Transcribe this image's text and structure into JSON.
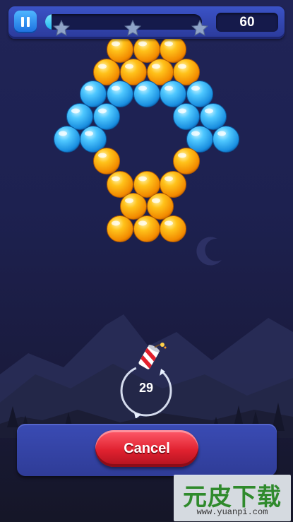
{
  "hud": {
    "score": "60",
    "progress_fraction": 0.04,
    "stars_earned": 0,
    "stars_total": 3
  },
  "board": {
    "colors": {
      "orange": "#f7a200",
      "blue": "#29a8ee"
    },
    "rows": [
      [
        "orange",
        "orange",
        "orange"
      ],
      [
        "orange",
        "orange",
        "orange",
        "orange"
      ],
      [
        "blue",
        "blue",
        "blue",
        "blue",
        "blue"
      ],
      [
        "blue",
        "blue",
        "blue",
        "blue"
      ],
      [
        "blue",
        "blue",
        "blue",
        "blue"
      ],
      [
        "orange",
        "orange"
      ],
      [
        "orange",
        "orange",
        "orange"
      ],
      [
        "orange",
        "orange"
      ],
      [
        "orange",
        "orange",
        "orange"
      ]
    ]
  },
  "shooter": {
    "shots_left": "29",
    "loaded_item": "firecracker-icon"
  },
  "panel": {
    "cancel_label": "Cancel"
  },
  "watermark": {
    "title": "元皮下载",
    "url": "www.yuanpi.com"
  },
  "accent_colors": {
    "hud": "#3447b4",
    "cancel": "#e0212f",
    "watermark_green": "#2f8a2c"
  }
}
